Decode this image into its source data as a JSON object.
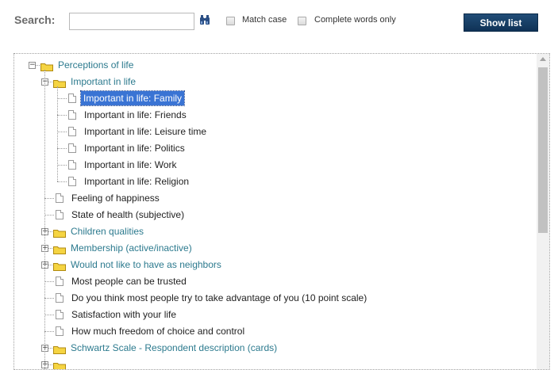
{
  "search": {
    "label": "Search:",
    "value": "",
    "placeholder": "",
    "match_case_label": "Match case",
    "match_case_checked": false,
    "complete_words_label": "Complete words only",
    "complete_words_checked": false,
    "show_list_label": "Show list"
  },
  "tree": {
    "root": {
      "label": "Perceptions of life",
      "expanded": true
    },
    "items": [
      {
        "label": "Important in life",
        "type": "folder",
        "level": 1,
        "expanded": true
      },
      {
        "label": "Important in life: Family",
        "type": "leaf",
        "level": 2,
        "selected": true
      },
      {
        "label": "Important in life: Friends",
        "type": "leaf",
        "level": 2
      },
      {
        "label": "Important in life: Leisure time",
        "type": "leaf",
        "level": 2
      },
      {
        "label": "Important in life: Politics",
        "type": "leaf",
        "level": 2
      },
      {
        "label": "Important in life: Work",
        "type": "leaf",
        "level": 2
      },
      {
        "label": "Important in life: Religion",
        "type": "leaf",
        "level": 2
      },
      {
        "label": "Feeling of happiness",
        "type": "leaf",
        "level": 1
      },
      {
        "label": "State of health (subjective)",
        "type": "leaf",
        "level": 1
      },
      {
        "label": "Children qualities",
        "type": "folder",
        "level": 1,
        "expanded": false
      },
      {
        "label": "Membership (active/inactive)",
        "type": "folder",
        "level": 1,
        "expanded": false
      },
      {
        "label": "Would not like to have as neighbors",
        "type": "folder",
        "level": 1,
        "expanded": false
      },
      {
        "label": "Most people can be trusted",
        "type": "leaf",
        "level": 1
      },
      {
        "label": "Do you think most people try to take advantage of you (10 point scale)",
        "type": "leaf",
        "level": 1
      },
      {
        "label": "Satisfaction with your life",
        "type": "leaf",
        "level": 1
      },
      {
        "label": "How much freedom of choice and control",
        "type": "leaf",
        "level": 1
      },
      {
        "label": "Schwartz Scale - Respondent description (cards)",
        "type": "folder",
        "level": 1,
        "expanded": false
      },
      {
        "label": "",
        "type": "folder",
        "level": 1,
        "expanded": false
      }
    ]
  },
  "colors": {
    "folder_text": "#2c7a8e",
    "selection": "#3a74d4",
    "button_bg": "#153b62",
    "folder_icon": "#f5d442"
  },
  "icons": {
    "search_button": "binoculars-icon",
    "folder": "folder-icon",
    "document": "document-icon",
    "expand": "plus-icon",
    "collapse": "minus-icon"
  }
}
